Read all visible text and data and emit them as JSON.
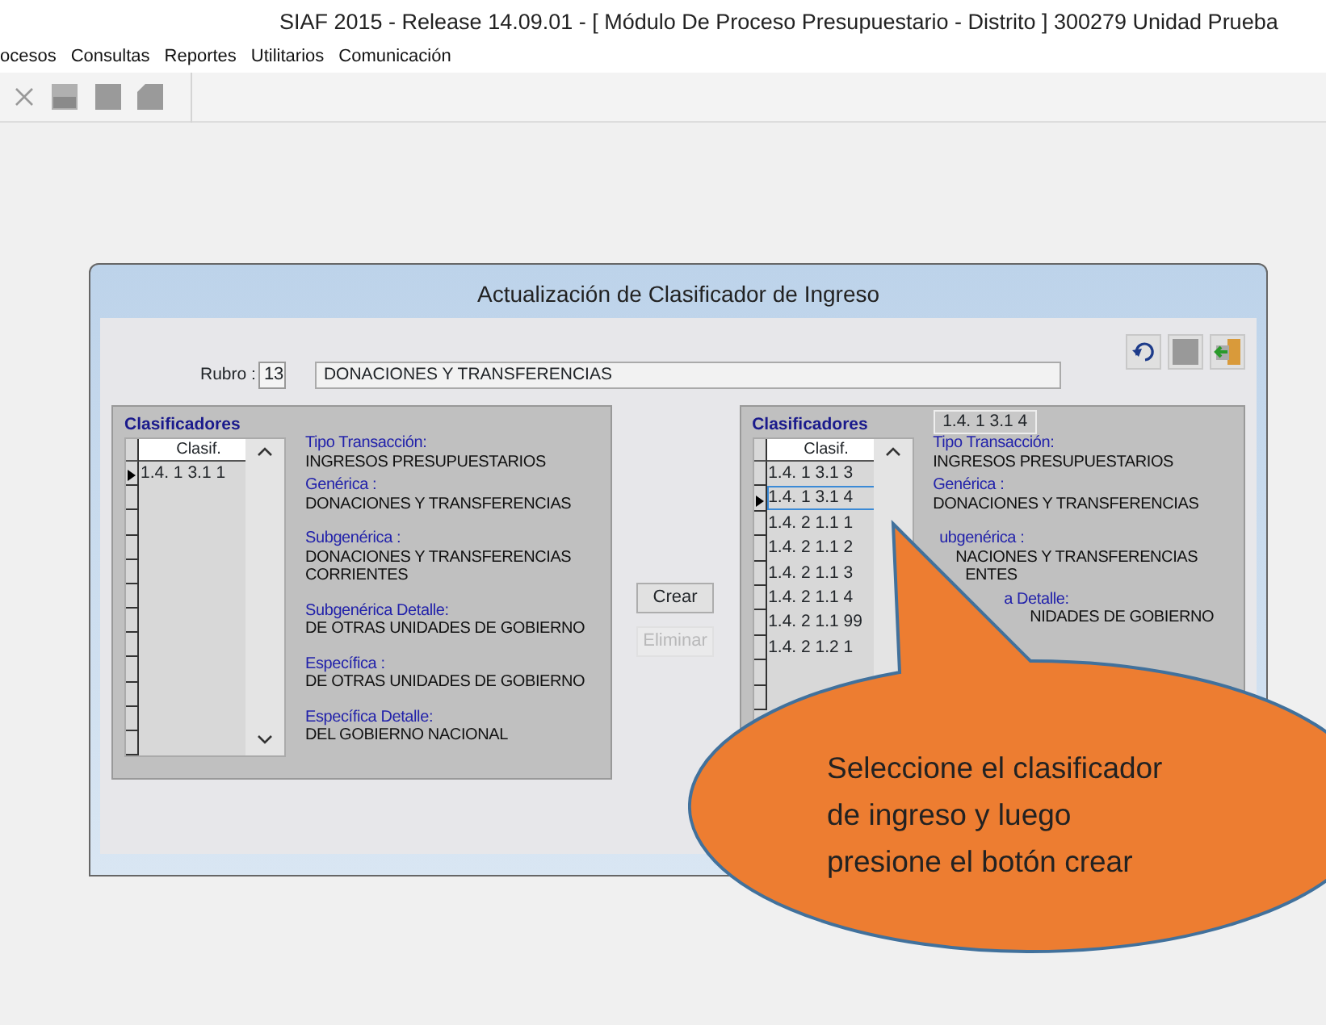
{
  "window": {
    "title": "SIAF 2015 - Release 14.09.01 - [ Módulo De Proceso Presupuestario - Distrito ] 300279 Unidad Prueba"
  },
  "menu": [
    "ocesos",
    "Consultas",
    "Reportes",
    "Utilitarios",
    "Comunicación"
  ],
  "dialog": {
    "title": "Actualización de Clasificador de Ingreso",
    "rubro": {
      "label": "Rubro :",
      "code": "13",
      "name": "DONACIONES Y TRANSFERENCIAS"
    },
    "panels": [
      {
        "heading": "Clasificadores",
        "focused": false,
        "column": "Clasif.",
        "rows": [
          {
            "code": "1.4. 1 3.1 1",
            "selected": true
          }
        ],
        "details": [
          {
            "kind": "label",
            "text": "Tipo Transacción:"
          },
          {
            "kind": "value",
            "text": "INGRESOS PRESUPUESTARIOS"
          },
          {
            "kind": "label",
            "text": "Genérica :"
          },
          {
            "kind": "value",
            "text": "DONACIONES Y TRANSFERENCIAS"
          },
          {
            "kind": "label",
            "text": "Subgenérica :"
          },
          {
            "kind": "value",
            "text": "DONACIONES Y TRANSFERENCIAS"
          },
          {
            "kind": "value",
            "text": "CORRIENTES"
          },
          {
            "kind": "label",
            "text": "Subgenérica Detalle:"
          },
          {
            "kind": "value",
            "text": "DE OTRAS UNIDADES DE GOBIERNO"
          },
          {
            "kind": "label",
            "text": "Específica :"
          },
          {
            "kind": "value",
            "text": "DE OTRAS UNIDADES DE GOBIERNO"
          },
          {
            "kind": "label",
            "text": "Específica Detalle:"
          },
          {
            "kind": "value",
            "text": "DEL GOBIERNO NACIONAL"
          }
        ]
      },
      {
        "heading": "Clasificadores",
        "current": "1.4. 1 3.1 4",
        "focused": true,
        "column": "Clasif.",
        "rows": [
          {
            "code": "1.4. 1 3.1 3",
            "selected": false
          },
          {
            "code": "1.4. 1 3.1 4",
            "selected": true
          },
          {
            "code": "1.4. 2 1.1 1",
            "selected": false
          },
          {
            "code": "1.4. 2 1.1 2",
            "selected": false
          },
          {
            "code": "1.4. 2 1.1 3",
            "selected": false
          },
          {
            "code": "1.4. 2 1.1 4",
            "selected": false
          },
          {
            "code": "1.4. 2 1.1 99",
            "selected": false
          },
          {
            "code": "1.4. 2 1.2 1",
            "selected": false
          }
        ],
        "details": [
          {
            "kind": "label",
            "text": "Tipo Transacción:"
          },
          {
            "kind": "value",
            "text": "INGRESOS PRESUPUESTARIOS"
          },
          {
            "kind": "label",
            "text": "Genérica :"
          },
          {
            "kind": "value",
            "text": "DONACIONES Y TRANSFERENCIAS"
          },
          {
            "kind": "label",
            "text": "ubgenérica :"
          },
          {
            "kind": "value",
            "text": "NACIONES Y TRANSFERENCIAS"
          },
          {
            "kind": "value",
            "text": "ENTES"
          },
          {
            "kind": "label",
            "text": "a Detalle:"
          },
          {
            "kind": "value",
            "text": "NIDADES DE GOBIERNO"
          }
        ]
      }
    ],
    "buttons": [
      {
        "label": "Crear",
        "disabled": false
      },
      {
        "label": "Eliminar",
        "disabled": true
      }
    ]
  },
  "callout": {
    "text": "Seleccione el clasificador\nde ingreso y luego\npresione el botón crear"
  }
}
